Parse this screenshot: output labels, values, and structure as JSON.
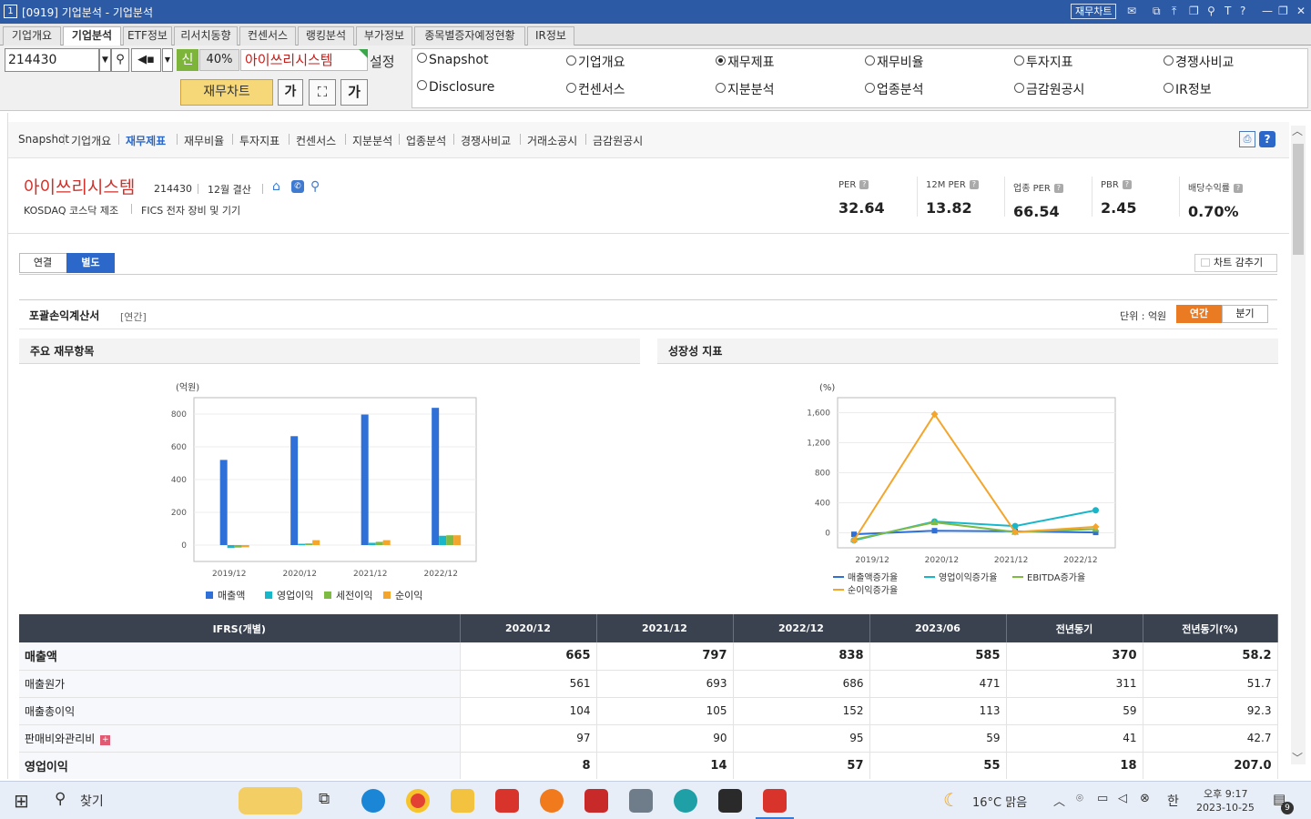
{
  "window": {
    "badge": "1",
    "title": "[0919] 기업분석 - 기업분석",
    "button": "재무차트"
  },
  "menu_tabs": [
    "기업개요",
    "기업분석",
    "ETF정보",
    "리서치동향",
    "컨센서스",
    "랭킹분석",
    "부가정보",
    "종목별증자예정현황",
    "IR정보"
  ],
  "menu_active": 1,
  "toolbar": {
    "code": "214430",
    "new_label": "신",
    "pct": "40%",
    "company": "아이쓰리시스템",
    "settings": "설정",
    "chart_button": "재무차트",
    "font_button": "가",
    "radios": [
      {
        "label": "Snapshot",
        "checked": false
      },
      {
        "label": "기업개요",
        "checked": false
      },
      {
        "label": "재무제표",
        "checked": true
      },
      {
        "label": "재무비율",
        "checked": false
      },
      {
        "label": "투자지표",
        "checked": false
      },
      {
        "label": "경쟁사비교",
        "checked": false
      },
      {
        "label": "Disclosure",
        "checked": false
      },
      {
        "label": "컨센서스",
        "checked": false
      },
      {
        "label": "지분분석",
        "checked": false
      },
      {
        "label": "업종분석",
        "checked": false
      },
      {
        "label": "금감원공시",
        "checked": false
      },
      {
        "label": "IR정보",
        "checked": false
      }
    ]
  },
  "subnav": [
    "Snapshot",
    "기업개요",
    "재무제표",
    "재무비율",
    "투자지표",
    "컨센서스",
    "지분분석",
    "업종분석",
    "경쟁사비교",
    "거래소공시",
    "금감원공시"
  ],
  "subnav_active": 2,
  "company": {
    "name": "아이쓰리시스템",
    "code": "214430",
    "fiscal": "12월 결산",
    "market": "KOSDAQ 코스닥 제조",
    "fics": "FICS 전자 장비 및 기기"
  },
  "metrics": [
    {
      "label": "PER",
      "value": "32.64"
    },
    {
      "label": "12M PER",
      "value": "13.82"
    },
    {
      "label": "업종 PER",
      "value": "66.54"
    },
    {
      "label": "PBR",
      "value": "2.45"
    },
    {
      "label": "배당수익률",
      "value": "0.70%"
    }
  ],
  "view_tabs": [
    "연결",
    "별도"
  ],
  "view_active": 1,
  "hide_chart": "차트 감추기",
  "statement": {
    "title": "포괄손익계산서",
    "period": "[연간]",
    "unit": "단위 : 억원",
    "toggle": [
      "연간",
      "분기"
    ],
    "toggle_active": 0
  },
  "panels": {
    "left": "주요 재무항목",
    "right": "성장성 지표"
  },
  "chart_data": [
    {
      "type": "bar",
      "ylabel": "(억원)",
      "ylim": [
        -100,
        900
      ],
      "yticks": [
        0,
        200,
        400,
        600,
        800
      ],
      "categories": [
        "2019/12",
        "2020/12",
        "2021/12",
        "2022/12"
      ],
      "series": [
        {
          "name": "매출액",
          "color": "#2e6fd8",
          "values": [
            520,
            665,
            797,
            838
          ]
        },
        {
          "name": "영업이익",
          "color": "#18b6c9",
          "values": [
            -18,
            8,
            14,
            57
          ]
        },
        {
          "name": "세전이익",
          "color": "#7dbb42",
          "values": [
            -15,
            10,
            20,
            60
          ]
        },
        {
          "name": "순이익",
          "color": "#f4a52b",
          "values": [
            -13,
            30,
            30,
            60
          ]
        }
      ]
    },
    {
      "type": "line",
      "ylabel": "(%)",
      "ylim": [
        -200,
        1800
      ],
      "yticks": [
        0,
        400,
        800,
        1200,
        1600
      ],
      "ytick_labels": [
        "0",
        "400",
        "800",
        "1,200",
        "1,600"
      ],
      "categories": [
        "2019/12",
        "2020/12",
        "2021/12",
        "2022/12"
      ],
      "series": [
        {
          "name": "매출액증가율",
          "color": "#2e6fd8",
          "marker": "square",
          "values": [
            -20,
            28,
            20,
            5
          ]
        },
        {
          "name": "영업이익증가율",
          "color": "#18b6c9",
          "marker": "circle",
          "values": [
            -100,
            150,
            90,
            300
          ]
        },
        {
          "name": "EBITDA증가율",
          "color": "#7dbb42",
          "marker": "triangle",
          "values": [
            -90,
            140,
            10,
            50
          ]
        },
        {
          "name": "순이익증가율",
          "color": "#f4a52b",
          "marker": "diamond",
          "values": [
            -100,
            1580,
            10,
            80
          ]
        }
      ]
    }
  ],
  "table": {
    "header": [
      "IFRS(개별)",
      "2020/12",
      "2021/12",
      "2022/12",
      "2023/06",
      "전년동기",
      "전년동기(%)"
    ],
    "rows": [
      {
        "name": "매출액",
        "bold": true,
        "values": [
          "665",
          "797",
          "838",
          "585",
          "370",
          "58.2"
        ]
      },
      {
        "name": "매출원가",
        "bold": false,
        "values": [
          "561",
          "693",
          "686",
          "471",
          "311",
          "51.7"
        ]
      },
      {
        "name": "매출총이익",
        "bold": false,
        "values": [
          "104",
          "105",
          "152",
          "113",
          "59",
          "92.3"
        ]
      },
      {
        "name": "판매비와관리비",
        "bold": false,
        "expand": "+",
        "values": [
          "97",
          "90",
          "95",
          "59",
          "41",
          "42.7"
        ]
      },
      {
        "name": "영업이익",
        "bold": true,
        "values": [
          "8",
          "14",
          "57",
          "55",
          "18",
          "207.0"
        ]
      }
    ]
  },
  "taskbar": {
    "search": "찾기",
    "weather": "16°C 맑음",
    "ime": "한",
    "time": "오후 9:17",
    "date": "2023-10-25",
    "notif": "9"
  }
}
